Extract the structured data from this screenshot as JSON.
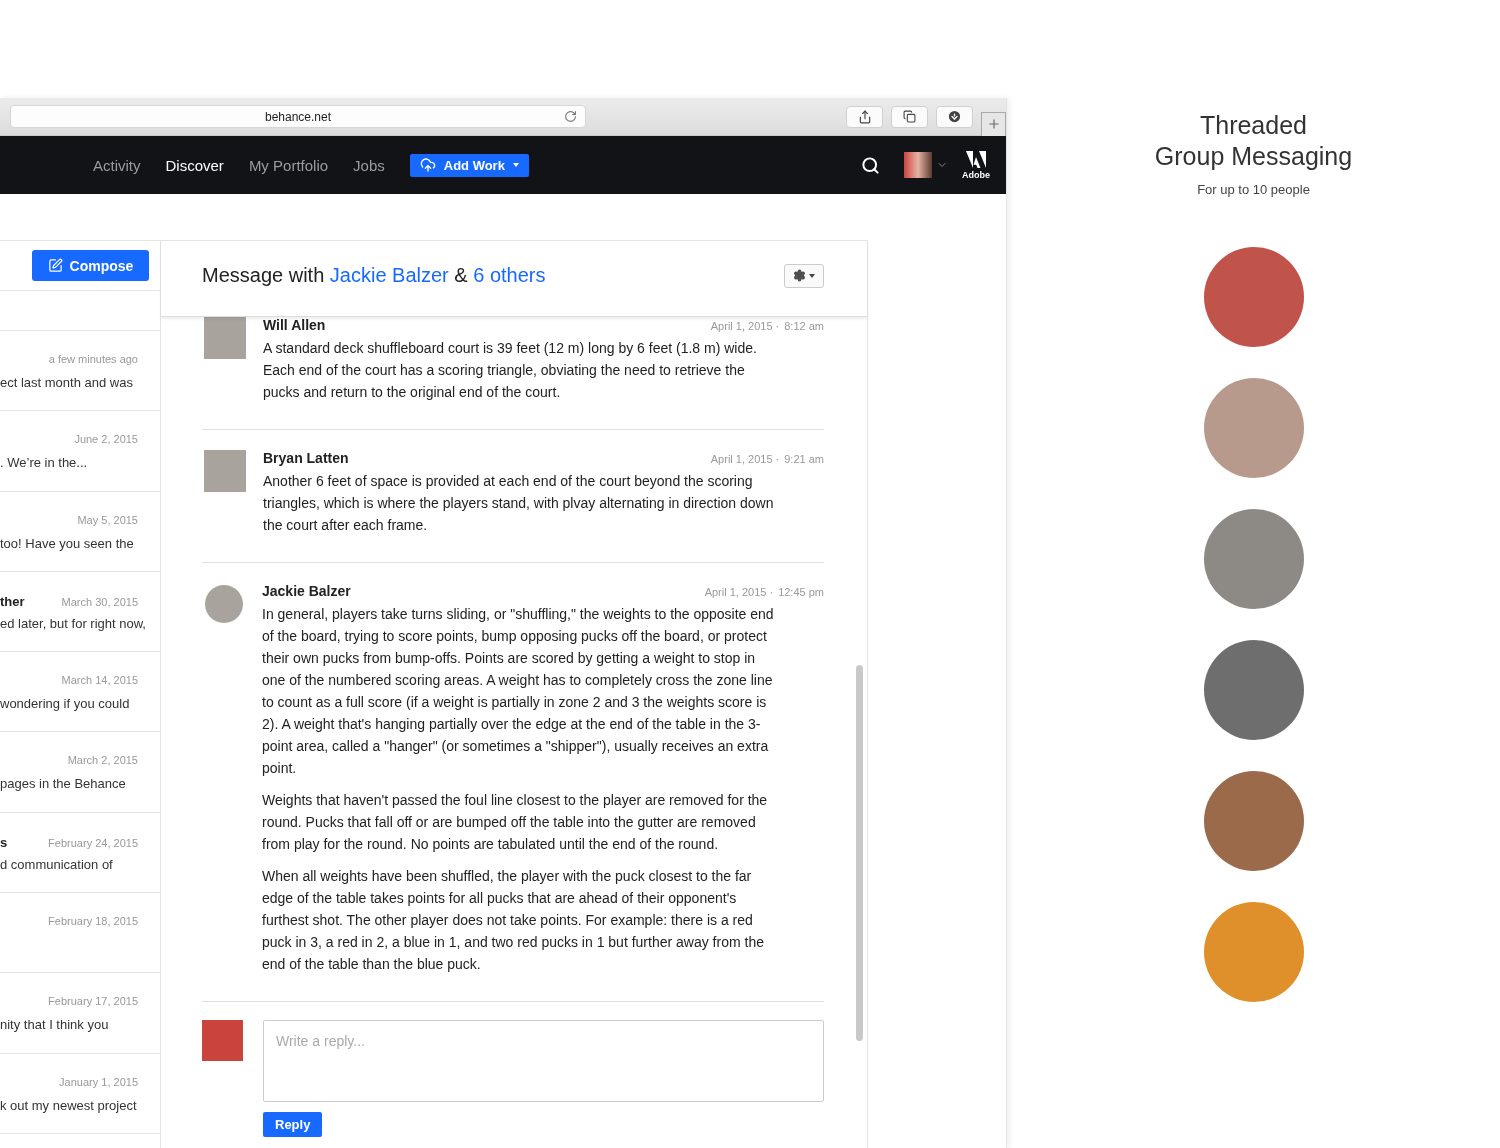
{
  "browser": {
    "url": "behance.net"
  },
  "nav": {
    "items": [
      {
        "label": "Activity",
        "selected": false
      },
      {
        "label": "Discover",
        "selected": true
      },
      {
        "label": "My Portfolio",
        "selected": false
      },
      {
        "label": "Jobs",
        "selected": false
      }
    ],
    "add_work": "Add Work",
    "adobe": "Adobe"
  },
  "sidebar": {
    "compose": "Compose",
    "items": [
      {
        "date": "a few minutes ago",
        "snippet": "ect last month and was"
      },
      {
        "date": "June 2, 2015",
        "snippet": ". We’re in the..."
      },
      {
        "date": "May 5, 2015",
        "snippet": "too! Have you seen the"
      },
      {
        "name": "ther",
        "date": "March 30, 2015",
        "snippet": "ed later, but for right now,"
      },
      {
        "date": "March 14, 2015",
        "snippet": "wondering if you could"
      },
      {
        "date": "March 2, 2015",
        "snippet": "pages in the Behance"
      },
      {
        "name": "s",
        "date": "February 24, 2015",
        "snippet": "d communication of"
      },
      {
        "date": "February 18, 2015"
      },
      {
        "date": "February 17, 2015",
        "snippet": "nity that I think you"
      },
      {
        "date": "January 1, 2015",
        "snippet": "k out my newest project"
      }
    ]
  },
  "thread": {
    "title_prefix": "Message with",
    "person": "Jackie Balzer",
    "joiner": "&",
    "others": "6 others",
    "messages": [
      {
        "author": "Will Allen",
        "date": "April 1, 2015 ·",
        "time": "8:12 am",
        "paragraphs": [
          "A standard deck shuffleboard court is 39 feet (12 m) long by 6 feet (1.8 m) wide. Each end of the court has a scoring triangle, obviating the need to retrieve the pucks and return to the original end of the court."
        ]
      },
      {
        "author": "Bryan Latten",
        "date": "April 1, 2015 ·",
        "time": "9:21 am",
        "paragraphs": [
          "Another 6 feet of space is provided at each end of the court beyond the scoring triangles, which is where the players stand, with plvay alternating in direction down the court after each frame."
        ]
      },
      {
        "author": "Jackie Balzer",
        "date": "April 1, 2015 ·",
        "time": "12:45 pm",
        "paragraphs": [
          "In general, players take turns sliding, or \"shuffling,\" the weights to the opposite end of the board, trying to score points, bump opposing pucks off the board, or protect their own pucks from bump-offs. Points are scored by getting a weight to stop in one of the numbered scoring areas. A weight has to completely cross the zone line to count as a full score (if a weight is partially in zone 2 and 3 the weights score is 2). A weight that's hanging partially over the edge at the end of the table in the 3-point area, called a \"hanger\" (or sometimes a \"shipper\"), usually receives an extra point.",
          "Weights that haven't passed the foul line closest to the player are removed for the round. Pucks that fall off or are bumped off the table into the gutter are removed from play for the round. No points are tabulated until the end of the round.",
          "When all weights have been shuffled, the player with the puck closest to the far edge of the table takes points for all pucks that are ahead of their opponent's furthest shot. The other player does not take points. For example: there is a red puck in 3, a red in 2, a blue in 1, and two red pucks in 1 but further away from the end of the table than the blue puck."
        ]
      }
    ],
    "reply": {
      "placeholder": "Write a reply...",
      "button": "Reply"
    }
  },
  "promo": {
    "title_lines": [
      "Threaded",
      "Group Messaging"
    ],
    "subtitle": "For up to 10 people",
    "avatars": [
      {
        "color": "#c0534a"
      },
      {
        "color": "#b79a8c"
      },
      {
        "color": "#8d8a86"
      },
      {
        "color": "#6e6e6e"
      },
      {
        "color": "#9a6a4a"
      },
      {
        "color": "#e0902a"
      }
    ]
  }
}
